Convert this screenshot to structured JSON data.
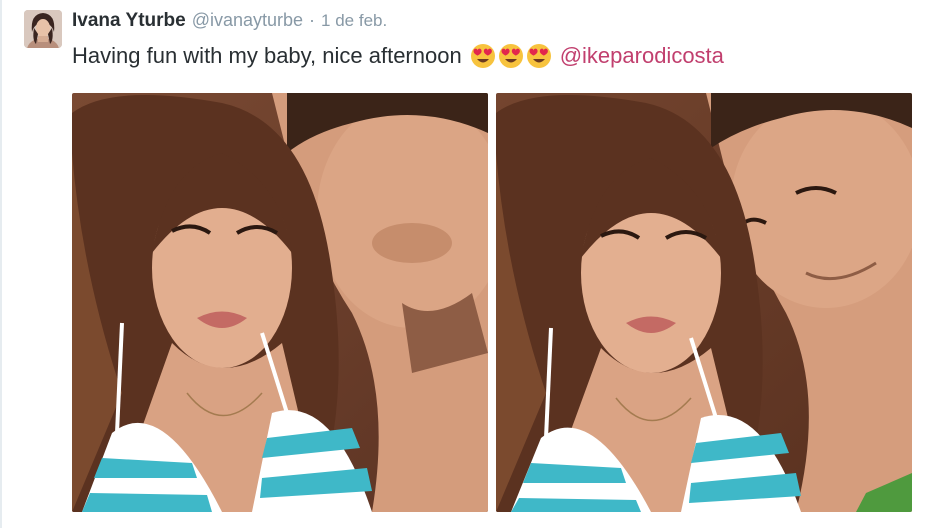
{
  "tweet": {
    "display_name": "Ivana Yturbe",
    "handle": "@ivanayturbe",
    "separator": "·",
    "timestamp": "1 de feb.",
    "text": "Having fun with my baby, nice afternoon",
    "emojis": [
      "heart-eyes-emoji",
      "heart-eyes-emoji",
      "heart-eyes-emoji"
    ],
    "mention": "@ikeparodicosta",
    "photos": [
      {
        "subject": "selfie-photo-1"
      },
      {
        "subject": "selfie-photo-2"
      }
    ]
  },
  "colors": {
    "name": "#292f33",
    "meta": "#8899a6",
    "mention": "#c13f6e",
    "bikini_stripe": "#3fb8c8"
  }
}
